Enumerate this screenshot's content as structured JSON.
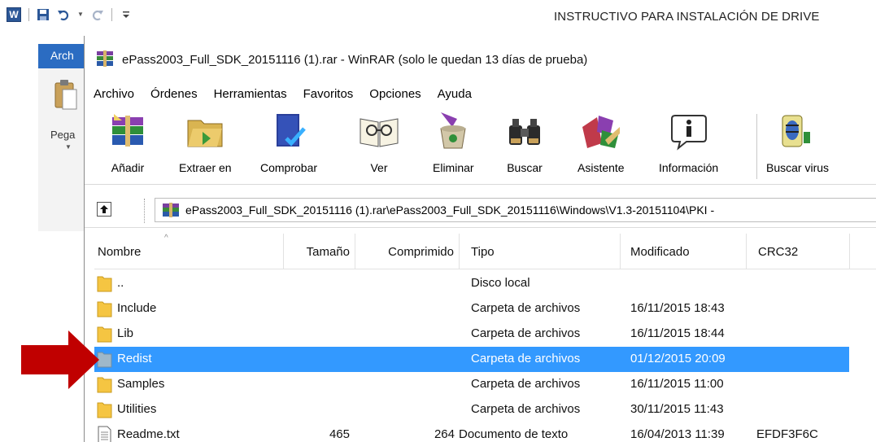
{
  "word": {
    "doc_title": "INSTRUCTIVO PARA INSTALACIÓN DE DRIVE",
    "tab_label": "Arch",
    "paste_label": "Pega",
    "qat_logo": "W"
  },
  "winrar": {
    "title": "ePass2003_Full_SDK_20151116 (1).rar - WinRAR (solo le quedan 13 días de prueba)",
    "menu": [
      "Archivo",
      "Órdenes",
      "Herramientas",
      "Favoritos",
      "Opciones",
      "Ayuda"
    ],
    "toolbar": [
      {
        "label": "Añadir",
        "icon": "add-archive-icon"
      },
      {
        "label": "Extraer en",
        "icon": "extract-icon"
      },
      {
        "label": "Comprobar",
        "icon": "test-icon"
      },
      {
        "label": "Ver",
        "icon": "view-icon"
      },
      {
        "label": "Eliminar",
        "icon": "delete-icon"
      },
      {
        "label": "Buscar",
        "icon": "find-icon"
      },
      {
        "label": "Asistente",
        "icon": "wizard-icon"
      },
      {
        "label": "Información",
        "icon": "info-icon"
      },
      {
        "label": "Buscar virus",
        "icon": "virus-scan-icon"
      }
    ],
    "path": "ePass2003_Full_SDK_20151116 (1).rar\\ePass2003_Full_SDK_20151116\\Windows\\V1.3-20151104\\PKI -",
    "columns": {
      "name": "Nombre",
      "size": "Tamaño",
      "packed": "Comprimido",
      "type": "Tipo",
      "modified": "Modificado",
      "crc": "CRC32"
    },
    "rows": [
      {
        "name": "..",
        "size": "",
        "packed": "",
        "type": "Disco local",
        "modified": "",
        "crc": "",
        "kind": "folder"
      },
      {
        "name": "Include",
        "size": "",
        "packed": "",
        "type": "Carpeta de archivos",
        "modified": "16/11/2015 18:43",
        "crc": "",
        "kind": "folder"
      },
      {
        "name": "Lib",
        "size": "",
        "packed": "",
        "type": "Carpeta de archivos",
        "modified": "16/11/2015 18:44",
        "crc": "",
        "kind": "folder"
      },
      {
        "name": "Redist",
        "size": "",
        "packed": "",
        "type": "Carpeta de archivos",
        "modified": "01/12/2015 20:09",
        "crc": "",
        "kind": "folder",
        "selected": true
      },
      {
        "name": "Samples",
        "size": "",
        "packed": "",
        "type": "Carpeta de archivos",
        "modified": "16/11/2015 11:00",
        "crc": "",
        "kind": "folder"
      },
      {
        "name": "Utilities",
        "size": "",
        "packed": "",
        "type": "Carpeta de archivos",
        "modified": "30/11/2015 11:43",
        "crc": "",
        "kind": "folder"
      },
      {
        "name": "Readme.txt",
        "size": "465",
        "packed": "264",
        "type": "Documento de texto",
        "modified": "16/04/2013 11:39",
        "crc": "EFDF3F6C",
        "kind": "text"
      }
    ]
  },
  "colors": {
    "selection": "#3399ff",
    "annotation_arrow": "#c00000",
    "folder": "#f5c542",
    "word_blue": "#2b6cc2"
  }
}
